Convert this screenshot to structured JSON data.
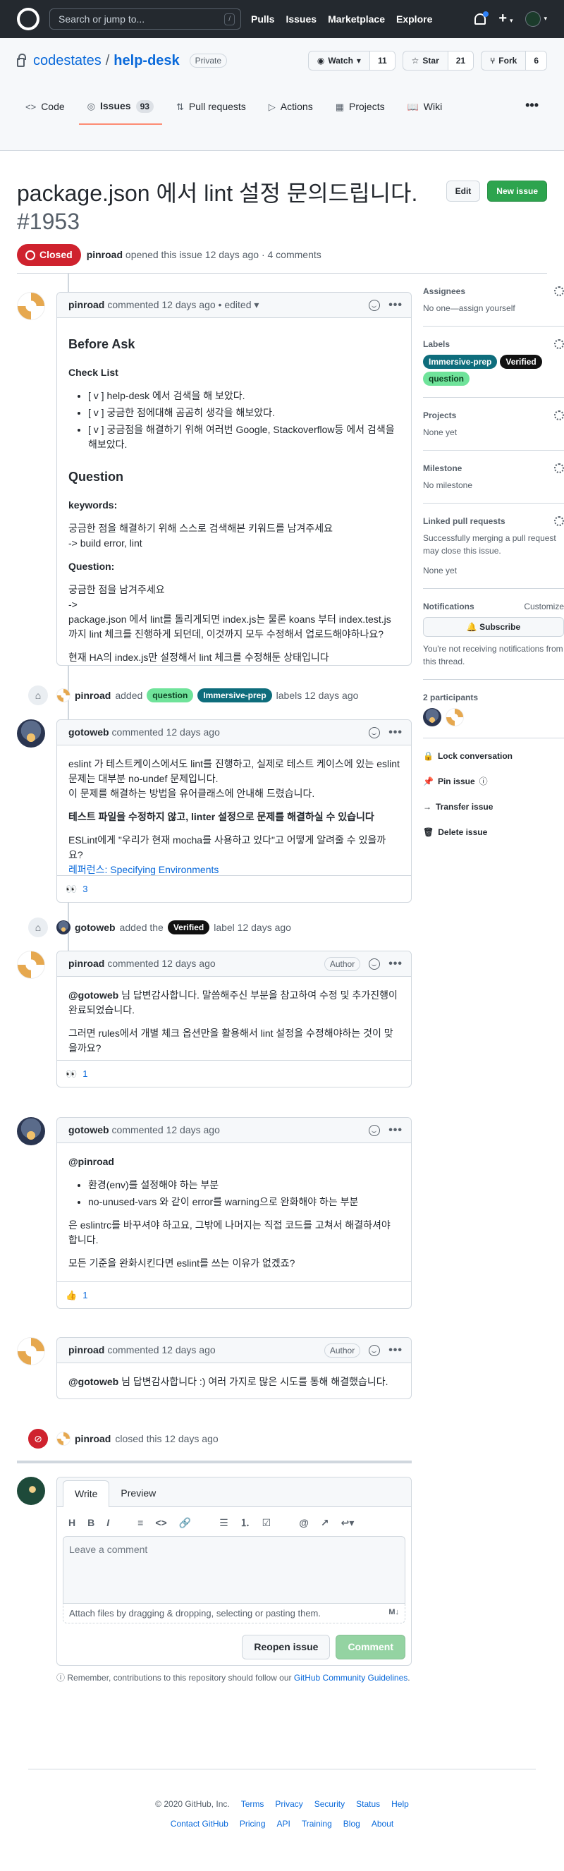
{
  "header": {
    "search_placeholder": "Search or jump to...",
    "slash": "/",
    "nav": [
      "Pulls",
      "Issues",
      "Marketplace",
      "Explore"
    ],
    "plus": "+",
    "caret": "▾"
  },
  "repo": {
    "owner": "codestates",
    "sep": "/",
    "name": "help-desk",
    "visibility": "Private",
    "watch_label": "Watch",
    "watch_count": "11",
    "star_label": "Star",
    "star_count": "21",
    "fork_label": "Fork",
    "fork_count": "6",
    "tabs": [
      {
        "label": "Code",
        "icon": "code-icon",
        "glyph": "<>"
      },
      {
        "label": "Issues",
        "icon": "issue-icon",
        "glyph": "◎",
        "count": "93"
      },
      {
        "label": "Pull requests",
        "icon": "pull-request-icon",
        "glyph": "⇅"
      },
      {
        "label": "Actions",
        "icon": "play-icon",
        "glyph": "▷"
      },
      {
        "label": "Projects",
        "icon": "project-icon",
        "glyph": "▦"
      },
      {
        "label": "Wiki",
        "icon": "book-icon",
        "glyph": "📖"
      }
    ],
    "more": "•••"
  },
  "issue": {
    "title": "package.json 에서 lint 설정 문의드립니다.",
    "number": "#1953",
    "edit_label": "Edit",
    "new_issue_label": "New issue",
    "state": "Closed",
    "author": "pinroad",
    "meta": "opened this issue 12 days ago · 4 comments"
  },
  "comments": [
    {
      "author": "pinroad",
      "meta": "commented 12 days ago • edited ▾",
      "blocks": {
        "h1": "Before Ask",
        "checklist_title": "Check List",
        "checklist": [
          "[ v ] help-desk 에서 검색을 해 보았다.",
          "[ v ] 궁금한 점에대해 곰곰히 생각을 해보았다.",
          "[ v ] 궁금점을 해결하기 위해 여러번 Google, Stackoverflow등 에서 검색을 해보았다."
        ],
        "question_h": "Question",
        "keywords_h": "keywords:",
        "keywords_1": "궁금한 점을 해결하기 위해 스스로 검색해본 키워드를 남겨주세요",
        "keywords_2": "-> build error, lint",
        "question_sub": "Question:",
        "q1": "궁금한 점을 남겨주세요",
        "q2": "->",
        "q3": "package.json 에서 lint를 돌리게되면 index.js는 물론 koans 부터 index.test.js 까지 lint 체크를 진행하게 되던데, 이것까지 모두 수정해서 업로드해야하나요?",
        "q4": "현재 HA의 index.js만 설정해서 lint 체크를 수정해둔 상태입니다"
      }
    },
    {
      "author": "gotoweb",
      "meta": "commented 12 days ago",
      "p1": "eslint 가 테스트케이스에서도 lint를 진행하고, 실제로 테스트 케이스에 있는 eslint 문제는 대부분 no-undef 문제입니다.",
      "p2": "이 문제를 해결하는 방법을 유어클래스에 안내해 드렸습니다.",
      "bold": "테스트 파일을 수정하지 않고, linter 설정으로 문제를 해결하실 수 있습니다",
      "p3": "ESLint에게 \"우리가 현재 mocha를 사용하고 있다\"고 어떻게 알려줄 수 있을까요?",
      "link": "레퍼런스: Specifying Environments",
      "reaction": "👀",
      "reaction_count": "3"
    },
    {
      "author": "pinroad",
      "meta": "commented 12 days ago",
      "badge": "Author",
      "p1_mention": "@gotoweb",
      "p1": " 님 답변감사합니다. 말씀해주신 부분을 참고하여 수정 및 추가진행이 완료되었습니다.",
      "p2": "그러면 rules에서 개별 체크 옵션만을 활용해서 lint 설정을 수정해야하는 것이 맞을까요?",
      "reaction": "👀",
      "reaction_count": "1"
    },
    {
      "author": "gotoweb",
      "meta": "commented 12 days ago",
      "mention": "@pinroad",
      "items": [
        "환경(env)를 설정해야 하는 부분",
        "no-unused-vars 와 같이 error를 warning으로 완화해야 하는 부분"
      ],
      "p1": "은 eslintrc를 바꾸셔야 하고요, 그밖에 나머지는 직접 코드를 고쳐서 해결하셔야 합니다.",
      "p2": "모든 기준을 완화시킨다면 eslint를 쓰는 이유가 없겠죠?",
      "reaction": "👍",
      "reaction_count": "1"
    },
    {
      "author": "pinroad",
      "meta": "commented 12 days ago",
      "badge": "Author",
      "mention": "@gotoweb",
      "text": " 님 답변감사합니다 :) 여러 가지로 많은 시도를 통해 해결했습니다."
    }
  ],
  "events": {
    "labels_added": {
      "actor": "pinroad",
      "verb": "added",
      "label1": "question",
      "label2": "Immersive-prep",
      "suffix": "labels 12 days ago"
    },
    "label_verified": {
      "actor": "gotoweb",
      "verb": "added the",
      "label": "Verified",
      "suffix": "label 12 days ago"
    },
    "closed": {
      "actor": "pinroad",
      "text": "closed this 12 days ago"
    }
  },
  "form": {
    "tab_write": "Write",
    "tab_preview": "Preview",
    "toolbar": [
      "H",
      "B",
      "I",
      "≡",
      "<>",
      "🔗",
      "☰",
      "⒈",
      "☑",
      "@",
      "↗",
      "↩▾"
    ],
    "placeholder": "Leave a comment",
    "attach": "Attach files by dragging & dropping, selecting or pasting them.",
    "md": "M↓",
    "reopen": "Reopen issue",
    "submit": "Comment",
    "guide_prefix": "Remember, contributions to this repository should follow our ",
    "guide_link": "GitHub Community Guidelines",
    "guide_suffix": "."
  },
  "sidebar": {
    "assignees_title": "Assignees",
    "assignees_text": "No one—assign yourself",
    "labels_title": "Labels",
    "labels": [
      {
        "name": "Immersive-prep",
        "bg": "#0e6d7c",
        "fg": "#ffffff"
      },
      {
        "name": "Verified",
        "bg": "#111111",
        "fg": "#ffffff"
      },
      {
        "name": "question",
        "bg": "#6fe39a",
        "fg": "#0b3d20"
      }
    ],
    "projects_title": "Projects",
    "projects_text": "None yet",
    "milestone_title": "Milestone",
    "milestone_text": "No milestone",
    "linked_title": "Linked pull requests",
    "linked_desc": "Successfully merging a pull request may close this issue.",
    "linked_text": "None yet",
    "notif_title": "Notifications",
    "notif_customize": "Customize",
    "subscribe": "Subscribe",
    "notif_text": "You're not receiving notifications from this thread.",
    "participants_title": "2 participants",
    "actions": [
      {
        "label": "Lock conversation",
        "icon": "lock-icon",
        "glyph": "🔒"
      },
      {
        "label": "Pin issue",
        "icon": "pin-icon",
        "glyph": "📌"
      },
      {
        "label": "Transfer issue",
        "icon": "arrow-right-icon",
        "glyph": "→"
      },
      {
        "label": "Delete issue",
        "icon": "trash-icon",
        "glyph": "🗑"
      }
    ]
  },
  "footer": {
    "copyright": "© 2020 GitHub, Inc.",
    "row1": [
      "Terms",
      "Privacy",
      "Security",
      "Status",
      "Help"
    ],
    "row2": [
      "Contact GitHub",
      "Pricing",
      "API",
      "Training",
      "Blog",
      "About"
    ]
  },
  "colors": {
    "closed_red": "#cf222e",
    "green": "#2da44e",
    "link_blue": "#0969da"
  }
}
